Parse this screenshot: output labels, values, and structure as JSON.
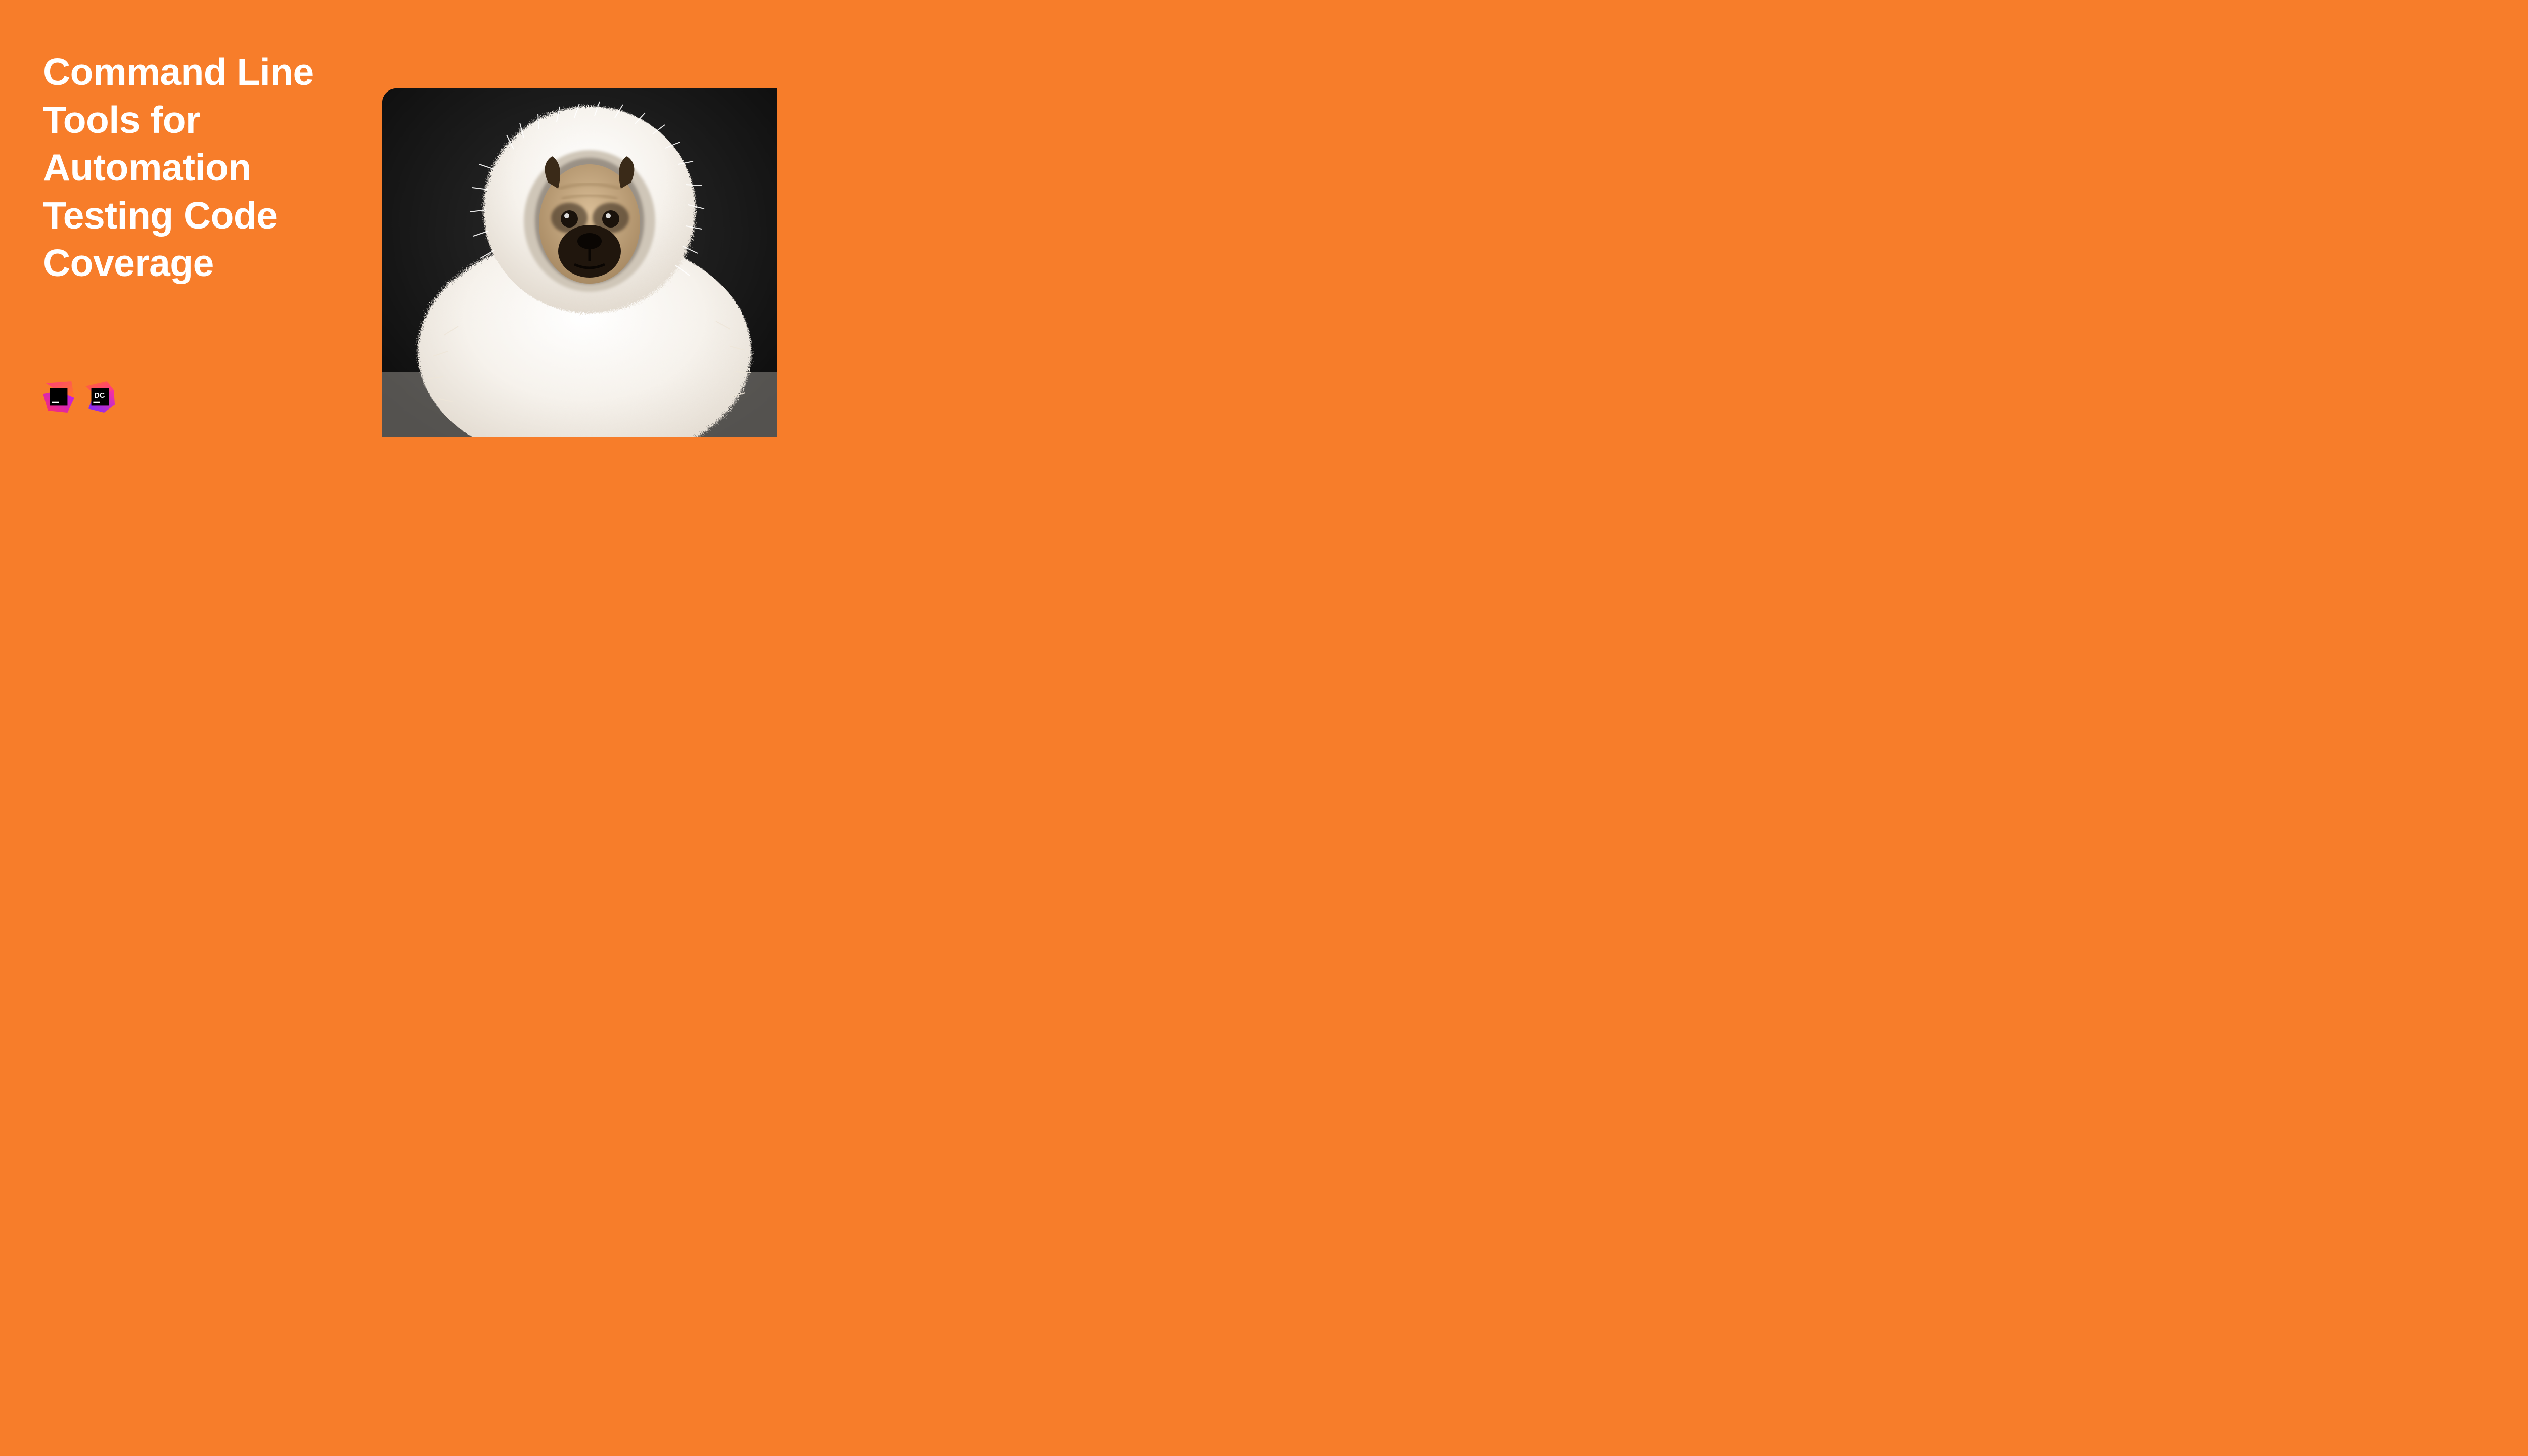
{
  "title": "Command Line Tools for Automation Testing Code Coverage",
  "logos": {
    "jetbrains": "JetBrains",
    "dotcover": "DC"
  },
  "colors": {
    "background": "#f77d2a",
    "text": "#ffffff"
  },
  "image": {
    "description": "pug-in-fluffy-blanket"
  }
}
